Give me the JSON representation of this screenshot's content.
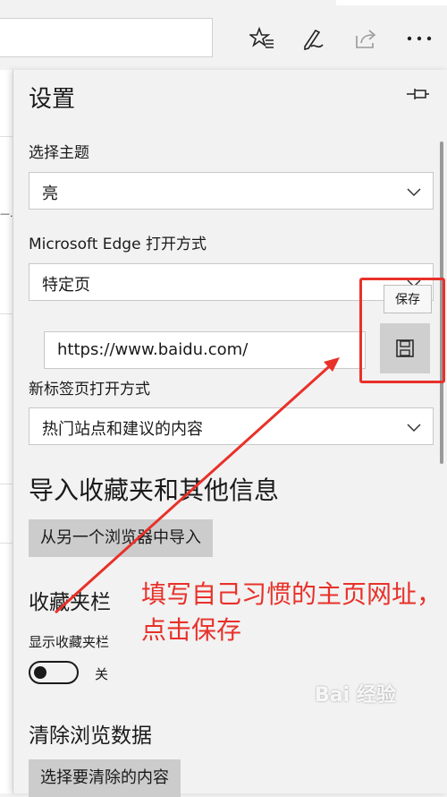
{
  "toolbar": {
    "icons": [
      "favorites-star-icon",
      "web-note-pen-icon",
      "share-icon",
      "more-icon"
    ]
  },
  "background": {
    "fragment": "—."
  },
  "settings": {
    "title": "设置",
    "theme": {
      "label": "选择主题",
      "value": "亮"
    },
    "open_with": {
      "label": "Microsoft Edge 打开方式",
      "value": "特定页"
    },
    "homepage_url": "https://www.baidu.com/",
    "save_tooltip": "保存",
    "new_tab": {
      "label": "新标签页打开方式",
      "value": "热门站点和建议的内容"
    },
    "import": {
      "heading": "导入收藏夹和其他信息",
      "button": "从另一个浏览器中导入"
    },
    "favorites_bar": {
      "heading": "收藏夹栏",
      "label": "显示收藏夹栏",
      "toggle_state": "关"
    },
    "clear_data": {
      "heading": "清除浏览数据",
      "button": "选择要清除的内容"
    }
  },
  "annotation": {
    "text": "填写自己习惯的主页网址，点击保存",
    "color": "#e8312a"
  },
  "watermark": "Bai 经验"
}
